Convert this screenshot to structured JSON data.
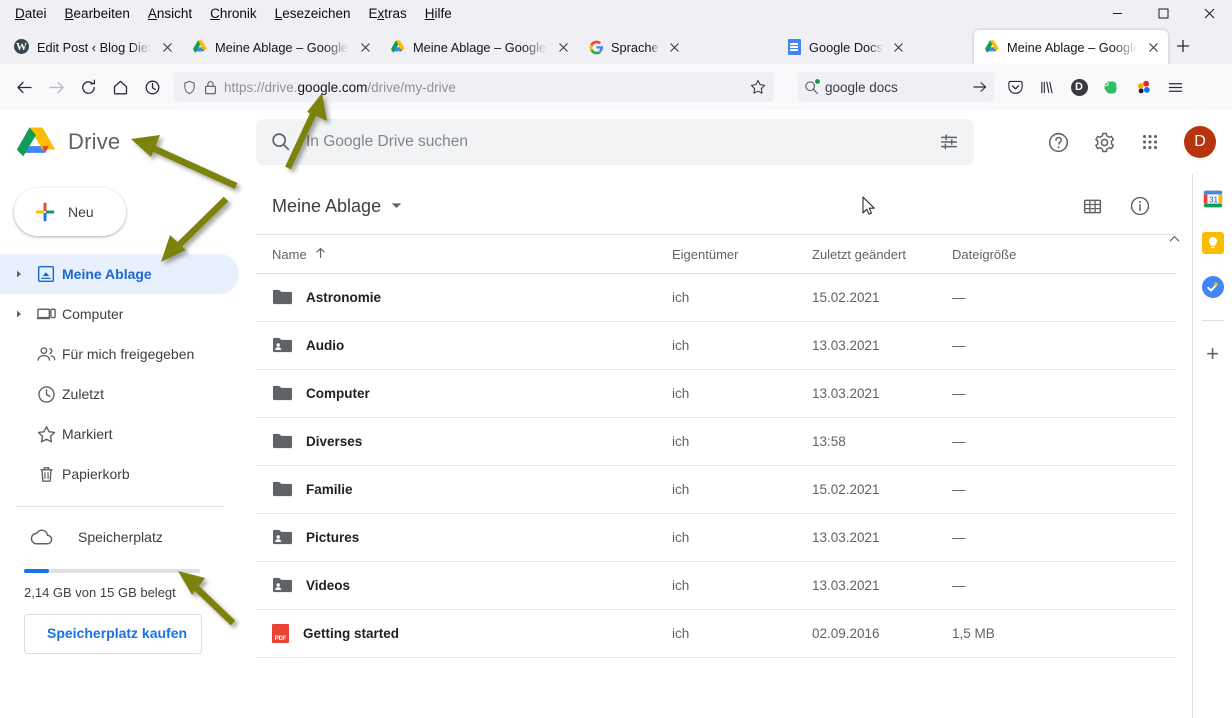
{
  "browser": {
    "menu": [
      {
        "label": "Datei",
        "accel": "D"
      },
      {
        "label": "Bearbeiten",
        "accel": "B"
      },
      {
        "label": "Ansicht",
        "accel": "A"
      },
      {
        "label": "Chronik",
        "accel": "C"
      },
      {
        "label": "Lesezeichen",
        "accel": "L"
      },
      {
        "label": "Extras",
        "accel": "x"
      },
      {
        "label": "Hilfe",
        "accel": "H"
      }
    ],
    "window_controls": {
      "minimize": "—",
      "maximize": "□",
      "close": "✕"
    },
    "tabs": [
      {
        "title": "Edit Post ‹ Blog Dietrich (St",
        "icon": "wordpress-icon",
        "active": false
      },
      {
        "title": "Meine Ablage – Google Dri",
        "icon": "drive-icon",
        "active": false
      },
      {
        "title": "Meine Ablage – Google Dri",
        "icon": "drive-icon",
        "active": false
      },
      {
        "title": "Sprache",
        "icon": "google-icon",
        "active": false
      },
      {
        "title": "Google Docs",
        "icon": "docs-icon",
        "active": false
      },
      {
        "title": "Meine Ablage – Google Dri",
        "icon": "drive-icon",
        "active": true
      }
    ],
    "new_tab_label": "+",
    "nav": {
      "back": "back-arrow-icon",
      "forward": "forward-arrow-icon",
      "reload": "reload-icon",
      "home": "home-icon",
      "history": "history-icon"
    },
    "url": {
      "prefix": "https://drive.",
      "domain": "google.com",
      "suffix": "/drive/my-drive",
      "full": "https://drive.google.com/drive/my-drive"
    },
    "search": {
      "value": "google docs",
      "go_label": "→"
    },
    "toolbar_icons": [
      "pocket-icon",
      "library-icon",
      "account-icon",
      "evernote-icon",
      "extension-icon",
      "hamburger-menu-icon"
    ],
    "account_initial": "D"
  },
  "drive": {
    "brand": "Drive",
    "search_placeholder": "In Google Drive suchen",
    "header_icons": [
      "help-icon",
      "settings-icon",
      "apps-grid-icon"
    ],
    "avatar_initial": "D",
    "new_button": "Neu",
    "sidebar": [
      {
        "label": "Meine Ablage",
        "icon": "my-drive-icon",
        "caret": true,
        "selected": true
      },
      {
        "label": "Computer",
        "icon": "computer-icon",
        "caret": true,
        "selected": false
      },
      {
        "label": "Für mich freigegeben",
        "icon": "shared-people-icon",
        "caret": false,
        "selected": false
      },
      {
        "label": "Zuletzt",
        "icon": "clock-icon",
        "caret": false,
        "selected": false
      },
      {
        "label": "Markiert",
        "icon": "star-icon",
        "caret": false,
        "selected": false
      },
      {
        "label": "Papierkorb",
        "icon": "trash-icon",
        "caret": false,
        "selected": false
      }
    ],
    "storage": {
      "label": "Speicherplatz",
      "icon": "cloud-icon",
      "used_text": "2,14 GB von 15 GB belegt",
      "percent": 14,
      "buy_button": "Speicherplatz kaufen"
    },
    "content": {
      "breadcrumb": "Meine Ablage",
      "view_icons": [
        "grid-view-icon",
        "details-info-icon"
      ],
      "columns": [
        "Name",
        "Eigentümer",
        "Zuletzt geändert",
        "Dateigröße"
      ],
      "sort_indicator": "↑",
      "rows": [
        {
          "name": "Astronomie",
          "icon": "folder-icon",
          "owner": "ich",
          "modified": "15.02.2021",
          "size": "—"
        },
        {
          "name": "Audio",
          "icon": "shared-folder-icon",
          "owner": "ich",
          "modified": "13.03.2021",
          "size": "—"
        },
        {
          "name": "Computer",
          "icon": "folder-icon",
          "owner": "ich",
          "modified": "13.03.2021",
          "size": "—"
        },
        {
          "name": "Diverses",
          "icon": "folder-icon",
          "owner": "ich",
          "modified": "13:58",
          "size": "—"
        },
        {
          "name": "Familie",
          "icon": "folder-icon",
          "owner": "ich",
          "modified": "15.02.2021",
          "size": "—"
        },
        {
          "name": "Pictures",
          "icon": "shared-folder-icon",
          "owner": "ich",
          "modified": "13.03.2021",
          "size": "—"
        },
        {
          "name": "Videos",
          "icon": "shared-folder-icon",
          "owner": "ich",
          "modified": "13.03.2021",
          "size": "—"
        },
        {
          "name": "Getting started",
          "icon": "pdf-icon",
          "owner": "ich",
          "modified": "02.09.2016",
          "size": "1,5 MB"
        }
      ]
    },
    "side_rail": [
      {
        "icon": "google-calendar-icon",
        "label": "31"
      },
      {
        "icon": "google-keep-icon",
        "label": ""
      },
      {
        "icon": "google-tasks-icon",
        "label": ""
      }
    ],
    "rail_add": "+"
  },
  "annotations": {
    "color": "#7c8308",
    "arrows": [
      {
        "name": "arrow-to-drive-logo",
        "target": "drive-brand"
      },
      {
        "name": "arrow-to-url",
        "target": "address-bar"
      },
      {
        "name": "arrow-to-my-drive",
        "target": "sidebar-my-drive"
      },
      {
        "name": "arrow-to-storage-text",
        "target": "storage-used-text"
      }
    ]
  }
}
